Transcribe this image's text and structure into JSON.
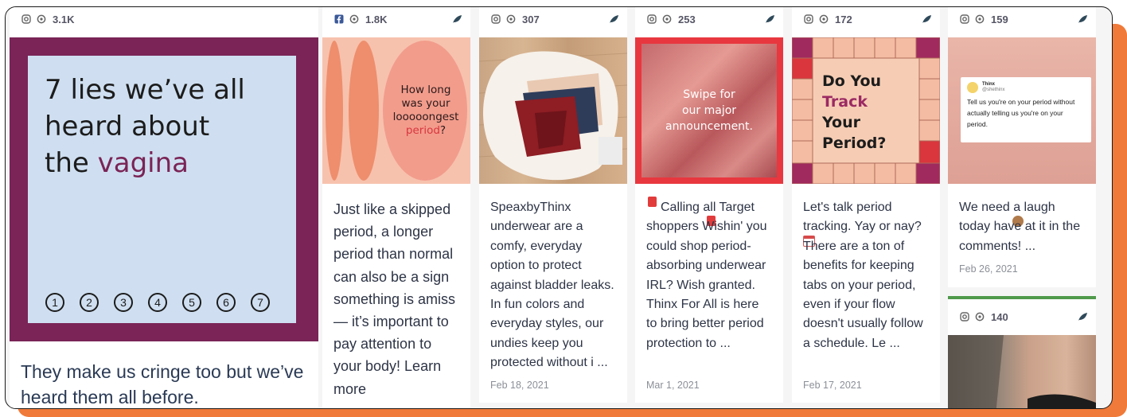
{
  "cards": [
    {
      "platform": "instagram",
      "count": "3.1K",
      "caption": "They make us cringe too but we’ve heard them all before.",
      "image": {
        "title_lines": [
          "7 lies we’ve all",
          "heard about"
        ],
        "title_prefix": "the",
        "title_highlight": "vagina",
        "numbers": [
          "1",
          "2",
          "3",
          "4",
          "5",
          "6",
          "7"
        ]
      }
    },
    {
      "platform": "facebook",
      "count": "1.8K",
      "caption": "Just like a skipped period, a longer period than normal can also be a sign something is amiss — it’s important to pay attention to your body! Learn more",
      "image": {
        "lines": [
          "How long",
          "was your",
          "looooongest"
        ],
        "highlight": "period",
        "suffix": "?"
      }
    },
    {
      "platform": "instagram",
      "count": "307",
      "caption": "SpeaxbyThinx underwear are a comfy, everyday option to protect against bladder leaks. In fun colors and everyday styles, our undies keep you protected without i ...",
      "date": "Feb 18, 2021"
    },
    {
      "platform": "instagram",
      "count": "253",
      "caption": "Calling all Target shoppers  Wishin' you could shop period-absorbing underwear IRL? Wish granted. Thinx For All is here to bring better period protection to ...",
      "date": "Mar 1, 2021",
      "image": {
        "lines": [
          "Swipe for",
          "our major",
          "announcement."
        ]
      }
    },
    {
      "platform": "instagram",
      "count": "172",
      "caption": "Let's talk period tracking. Yay or nay?  There are a ton of benefits for keeping tabs on your period, even if your flow doesn't usually follow a schedule. Le ...",
      "date": "Feb 17, 2021",
      "image": {
        "l1": "Do You",
        "highlight": "Track",
        "l3": "Your",
        "l4": "Period?"
      }
    },
    {
      "platform": "instagram",
      "count": "159",
      "caption": "We need a laugh today  have at it in the comments! ...",
      "date": "Feb 26, 2021",
      "image": {
        "tweet_name": "Thinx",
        "tweet_handle": "@shethinx",
        "tweet_text": "Tell us you're on your period without actually telling us you're on your period."
      }
    },
    {
      "platform": "instagram",
      "count": "140"
    }
  ],
  "colors": {
    "plum": "#7a2457",
    "light_blue": "#cfdff1",
    "orange": "#f07a3a",
    "peach": "#f4a892",
    "red": "#d9363e",
    "target_red": "#e8373f",
    "board_peach": "#f6cdb4",
    "green_bar": "#4f9a4b"
  }
}
